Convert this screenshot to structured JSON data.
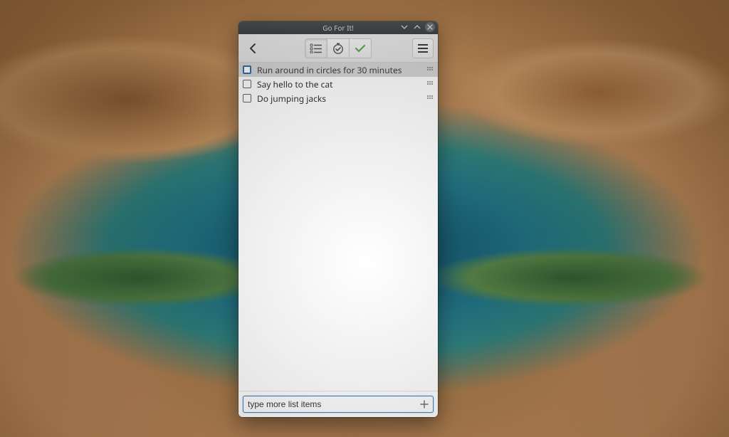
{
  "window": {
    "title": "Go For It!"
  },
  "toolbar": {
    "tabs": {
      "list_icon": "list-bullets-icon",
      "timer_icon": "timer-check-icon",
      "done_icon": "check-icon"
    },
    "active_tab": "list"
  },
  "tasks": [
    {
      "label": "Run around in circles for 30 minutes",
      "checked": false,
      "selected": true
    },
    {
      "label": "Say hello to the cat",
      "checked": false,
      "selected": false
    },
    {
      "label": "Do jumping jacks",
      "checked": false,
      "selected": false
    }
  ],
  "input": {
    "value": "type more list items",
    "placeholder": "type more list items"
  },
  "icons": {
    "back": "chevron-left-icon",
    "menu": "hamburger-icon",
    "add": "plus-icon",
    "drag": "drag-handle-icon",
    "minimize": "chevron-down-icon",
    "maximize": "chevron-up-icon",
    "close": "close-icon"
  },
  "colors": {
    "accent": "#3b82c4",
    "check_green": "#5aa84f"
  }
}
